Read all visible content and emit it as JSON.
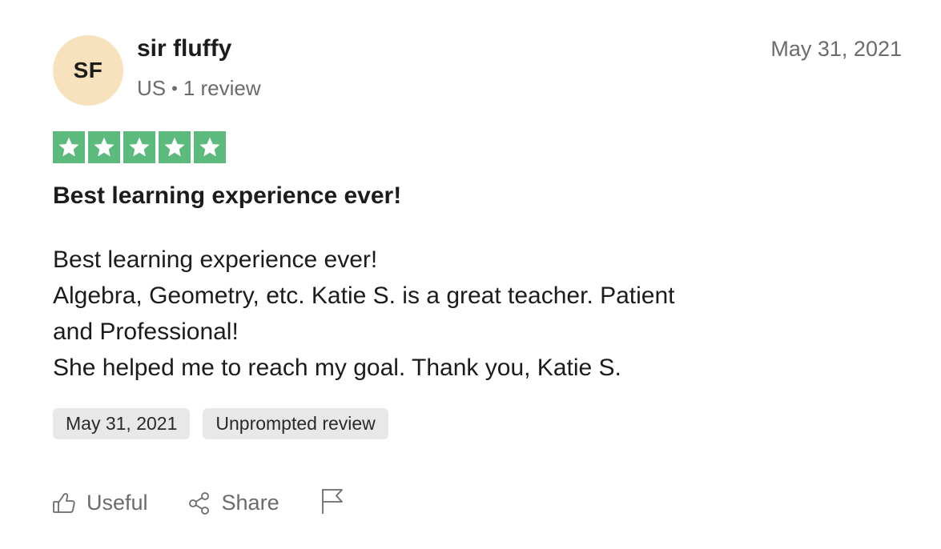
{
  "reviewer": {
    "initials": "SF",
    "name": "sir fluffy",
    "country": "US",
    "separator": "•",
    "review_count": "1 review",
    "avatar_color": "#f7e2bd"
  },
  "review": {
    "date": "May 31, 2021",
    "rating": 5,
    "rating_max": 5,
    "star_color": "#5dba7d",
    "title": "Best learning experience ever!",
    "body_lines": [
      "Best learning experience ever!",
      "Algebra, Geometry, etc. Katie S. is a great teacher. Patient",
      "and Professional!",
      "She helped me to reach my goal. Thank you, Katie S."
    ],
    "tags": [
      "May 31, 2021",
      "Unprompted review"
    ]
  },
  "actions": {
    "useful_label": "Useful",
    "useful_icon": "thumbs-up-icon",
    "share_label": "Share",
    "share_icon": "share-icon",
    "report_icon": "flag-icon"
  }
}
